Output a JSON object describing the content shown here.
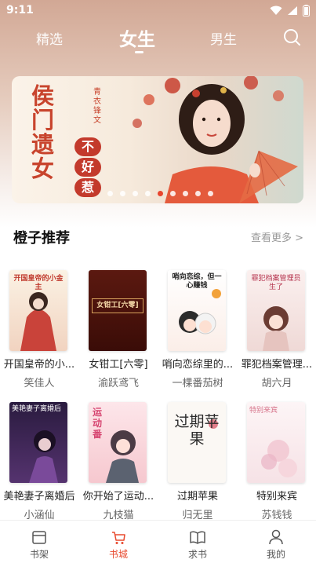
{
  "status_bar": {
    "time": "9:11"
  },
  "top_nav": {
    "tabs": [
      {
        "label": "精选"
      },
      {
        "label": "女生"
      },
      {
        "label": "男生"
      }
    ]
  },
  "banner": {
    "title": "侯门遗女",
    "subtitle": "青衣锋文",
    "badge": [
      "不",
      "好",
      "惹"
    ],
    "dot_count": 9,
    "active_dot": 4
  },
  "section": {
    "title": "橙子推荐",
    "more": "查看更多 >"
  },
  "books": [
    {
      "title": "开国皇帝的小...",
      "author": "笑佳人",
      "cover_text": "开国皇帝的小金主"
    },
    {
      "title": "女钳工[六零]",
      "author": "渝跃鸢飞",
      "cover_text": "女钳工[六零]"
    },
    {
      "title": "哨向恋综里的...",
      "author": "一棵番茄树",
      "cover_text": "哨向恋综，但一心赚钱"
    },
    {
      "title": "罪犯档案管理...",
      "author": "胡六月",
      "cover_text": "罪犯档案管理员生了"
    },
    {
      "title": "美艳妻子离婚后",
      "author": "小涵仙",
      "cover_text": "美艳妻子离婚后"
    },
    {
      "title": "你开始了运动...",
      "author": "九枝猫",
      "cover_text": "运动番"
    },
    {
      "title": "过期苹果",
      "author": "归无里",
      "cover_text": "过期苹果"
    },
    {
      "title": "特别来宾",
      "author": "苏钱钱",
      "cover_text": "特别来宾"
    }
  ],
  "bottom_nav": {
    "items": [
      {
        "label": "书架",
        "icon": "bookshelf-icon"
      },
      {
        "label": "书城",
        "icon": "bookstore-icon",
        "active": true
      },
      {
        "label": "求书",
        "icon": "request-book-icon"
      },
      {
        "label": "我的",
        "icon": "profile-icon"
      }
    ]
  },
  "colors": {
    "accent": "#e84a2f",
    "banner_red": "#c8442d"
  }
}
